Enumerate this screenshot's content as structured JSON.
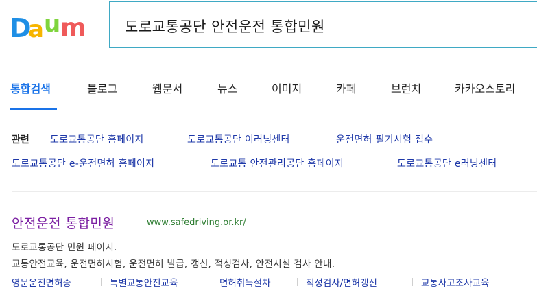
{
  "logo": {
    "text": "Daum",
    "colors": [
      "#1f8fe5",
      "#f7b500",
      "#7fd43d",
      "#ef5a5a"
    ]
  },
  "search": {
    "query": "도로교통공단 안전운전 통합민원"
  },
  "tabs": [
    {
      "label": "통합검색",
      "active": true
    },
    {
      "label": "블로그"
    },
    {
      "label": "웹문서"
    },
    {
      "label": "뉴스"
    },
    {
      "label": "이미지"
    },
    {
      "label": "카페"
    },
    {
      "label": "브런치"
    },
    {
      "label": "카카오스토리"
    }
  ],
  "related": {
    "label": "관련",
    "links": [
      "도로교통공단 홈페이지",
      "도로교통공단 이러닝센터",
      "운전면허 필기시험 접수",
      "도로교통공단 e-운전면허 홈페이지",
      "도로교통 안전관리공단 홈페이지",
      "도로교통공단 e러닝센터"
    ]
  },
  "result": {
    "title": "안전운전 통합민원",
    "url": "www.safedriving.or.kr/",
    "desc_line1": "도로교통공단 민원 페이지.",
    "desc_line2": "교통안전교육, 운전면허시험, 운전면허 발급, 갱신, 적성검사, 안전시설 검사 안내.",
    "sublinks": [
      "영문운전면허증",
      "특별교통안전교육",
      "면허취득절차",
      "적성검사/면허갱신",
      "교통사고조사교육"
    ]
  }
}
